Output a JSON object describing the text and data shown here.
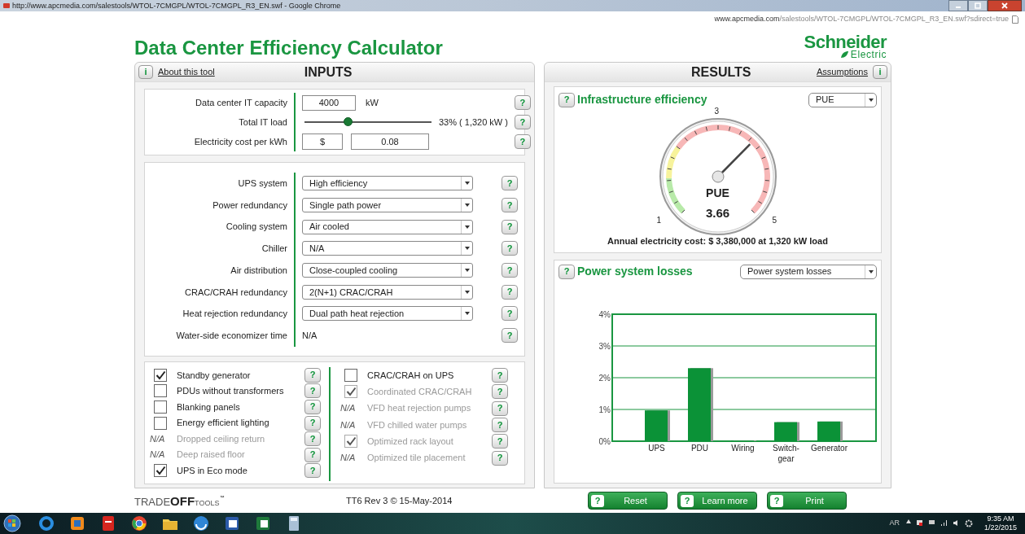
{
  "window": {
    "title": "http://www.apcmedia.com/salestools/WTOL-7CMGPL/WTOL-7CMGPL_R3_EN.swf - Google Chrome",
    "url_host": "www.apcmedia.com",
    "url_path": "/salestools/WTOL-7CMGPL/WTOL-7CMGPL_R3_EN.swf?sdirect=true"
  },
  "header": {
    "title": "Data Center Efficiency Calculator",
    "logo_name": "Schneider",
    "logo_sub": "Electric"
  },
  "inputs": {
    "info": "i",
    "about_link": "About this tool",
    "title": "INPUTS",
    "capacity": {
      "label": "Data center IT capacity",
      "value": "4000",
      "unit": "kW",
      "help": "?"
    },
    "it_load": {
      "label": "Total IT load",
      "level": 0.33,
      "reading": "33% ( 1,320 kW )",
      "help": "?"
    },
    "cost": {
      "label": "Electricity cost per kWh",
      "currency": "$",
      "value": "0.08",
      "help": "?"
    },
    "settings": [
      {
        "kind": "select",
        "label": "UPS system",
        "value": "High efficiency",
        "help": "?"
      },
      {
        "kind": "select",
        "label": "Power redundancy",
        "value": "Single path power",
        "help": "?"
      },
      {
        "kind": "select",
        "label": "Cooling system",
        "value": "Air cooled",
        "help": "?"
      },
      {
        "kind": "select",
        "label": "Chiller",
        "value": "N/A",
        "help": "?"
      },
      {
        "kind": "select",
        "label": "Air distribution",
        "value": "Close-coupled cooling",
        "help": "?"
      },
      {
        "kind": "select",
        "label": "CRAC/CRAH redundancy",
        "value": "2(N+1) CRAC/CRAH",
        "help": "?"
      },
      {
        "kind": "select",
        "label": "Heat rejection redundancy",
        "value": "Dual path heat rejection",
        "help": "?"
      },
      {
        "kind": "text",
        "label": "Water-side economizer time",
        "value": "N/A",
        "help": "?"
      }
    ],
    "options_left": [
      {
        "kind": "checkbox",
        "label": "Standby generator",
        "checked": true,
        "disabled": false,
        "help": "?"
      },
      {
        "kind": "checkbox",
        "label": "PDUs without transformers",
        "checked": false,
        "disabled": false,
        "help": "?"
      },
      {
        "kind": "checkbox",
        "label": "Blanking panels",
        "checked": false,
        "disabled": false,
        "help": "?"
      },
      {
        "kind": "checkbox",
        "label": "Energy efficient lighting",
        "checked": false,
        "disabled": false,
        "help": "?"
      },
      {
        "kind": "na",
        "marker": "N/A",
        "label": "Dropped ceiling return",
        "help": "?"
      },
      {
        "kind": "na",
        "marker": "N/A",
        "label": "Deep raised floor",
        "help": "?"
      },
      {
        "kind": "checkbox",
        "label": "UPS in Eco mode",
        "checked": true,
        "disabled": false,
        "help": "?"
      }
    ],
    "options_right": [
      {
        "kind": "checkbox",
        "label": "CRAC/CRAH on UPS",
        "checked": false,
        "disabled": false,
        "help": "?"
      },
      {
        "kind": "checkbox",
        "label": "Coordinated CRAC/CRAH",
        "checked": true,
        "disabled": true,
        "help": "?"
      },
      {
        "kind": "na",
        "marker": "N/A",
        "label": "VFD heat rejection pumps",
        "help": "?"
      },
      {
        "kind": "na",
        "marker": "N/A",
        "label": "VFD chilled water pumps",
        "help": "?"
      },
      {
        "kind": "checkbox",
        "label": "Optimized rack layout",
        "checked": true,
        "disabled": true,
        "help": "?"
      },
      {
        "kind": "na",
        "marker": "N/A",
        "label": "Optimized tile placement",
        "help": "?"
      }
    ]
  },
  "results": {
    "title": "RESULTS",
    "assumptions_link": "Assumptions",
    "info": "i",
    "efficiency": {
      "help": "?",
      "title": "Infrastructure efficiency",
      "dropdown": "PUE",
      "gauge": {
        "tick_min": "1",
        "tick_mid": "3",
        "tick_max": "5",
        "metric": "PUE",
        "value": "3.66",
        "level": 0.665
      },
      "annual_cost": "Annual electricity cost: $ 3,380,000 at 1,320 kW load"
    },
    "losses": {
      "help": "?",
      "title": "Power system losses",
      "dropdown": "Power system losses",
      "chart_data": {
        "type": "bar",
        "categories": [
          "UPS",
          "PDU",
          "Wiring",
          "Switch-gear",
          "Generator"
        ],
        "series": [
          {
            "color": "#0b9237",
            "values": [
              0.97,
              2.3,
              0.02,
              0.6,
              0.62
            ]
          }
        ],
        "grid": true,
        "ylim": [
          0,
          4
        ],
        "yticks": [
          {
            "value": 0,
            "label": "0%"
          },
          {
            "value": 1,
            "label": "1%"
          },
          {
            "value": 2,
            "label": "2%"
          },
          {
            "value": 3,
            "label": "3%"
          },
          {
            "value": 4,
            "label": "4%"
          }
        ]
      }
    }
  },
  "footer": {
    "brand": [
      "TRADE",
      "OFF",
      "TOOLS",
      "™"
    ],
    "version": "TT6 Rev 3 © 15-May-2014",
    "buttons": [
      {
        "help": "?",
        "label": "Reset"
      },
      {
        "help": "?",
        "label": "Learn more"
      },
      {
        "help": "?",
        "label": "Print"
      }
    ]
  },
  "taskbar": {
    "language": "AR",
    "time": "9:35 AM",
    "date": "1/22/2015"
  }
}
